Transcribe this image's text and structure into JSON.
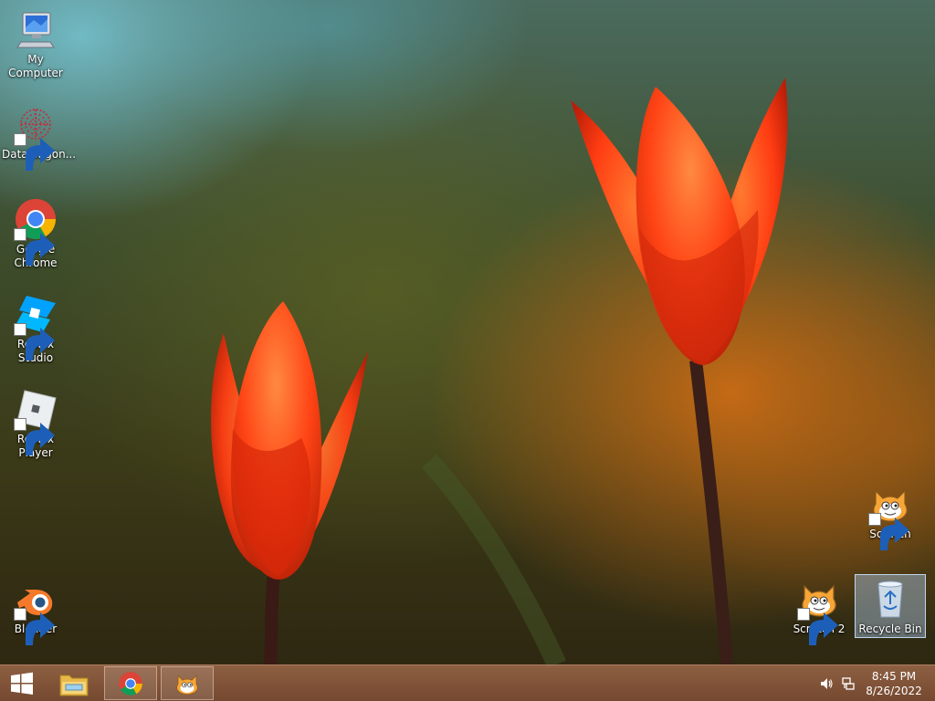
{
  "desktop_icons": [
    {
      "label": "My Computer",
      "icon": "my-computer-icon",
      "shortcut": false
    },
    {
      "label": "DataWagon...",
      "icon": "datawagon-icon",
      "shortcut": true
    },
    {
      "label": "Google Chrome",
      "icon": "chrome-icon",
      "shortcut": true
    },
    {
      "label": "Roblox Studio",
      "icon": "roblox-studio-icon",
      "shortcut": true
    },
    {
      "label": "Roblox Player",
      "icon": "roblox-player-icon",
      "shortcut": true
    },
    {
      "label": "Blender",
      "icon": "blender-icon",
      "shortcut": true
    },
    {
      "label": "Scratch",
      "icon": "scratch-icon",
      "shortcut": true
    },
    {
      "label": "Scratch 2",
      "icon": "scratch-icon",
      "shortcut": true
    },
    {
      "label": "Recycle Bin",
      "icon": "recycle-bin-icon",
      "shortcut": false,
      "selected": true
    }
  ],
  "taskbar": {
    "start": "windows-start-icon",
    "pinned": [
      "file-explorer-icon",
      "chrome-icon",
      "scratch-icon"
    ],
    "tray_icons": [
      "volume-icon",
      "network-icon"
    ],
    "clock": {
      "time": "8:45 PM",
      "date": "8/26/2022"
    }
  },
  "colors": {
    "taskbar": "#8a5a3e",
    "selection": "#aac8e6",
    "tulip": "#ff4a1a"
  }
}
